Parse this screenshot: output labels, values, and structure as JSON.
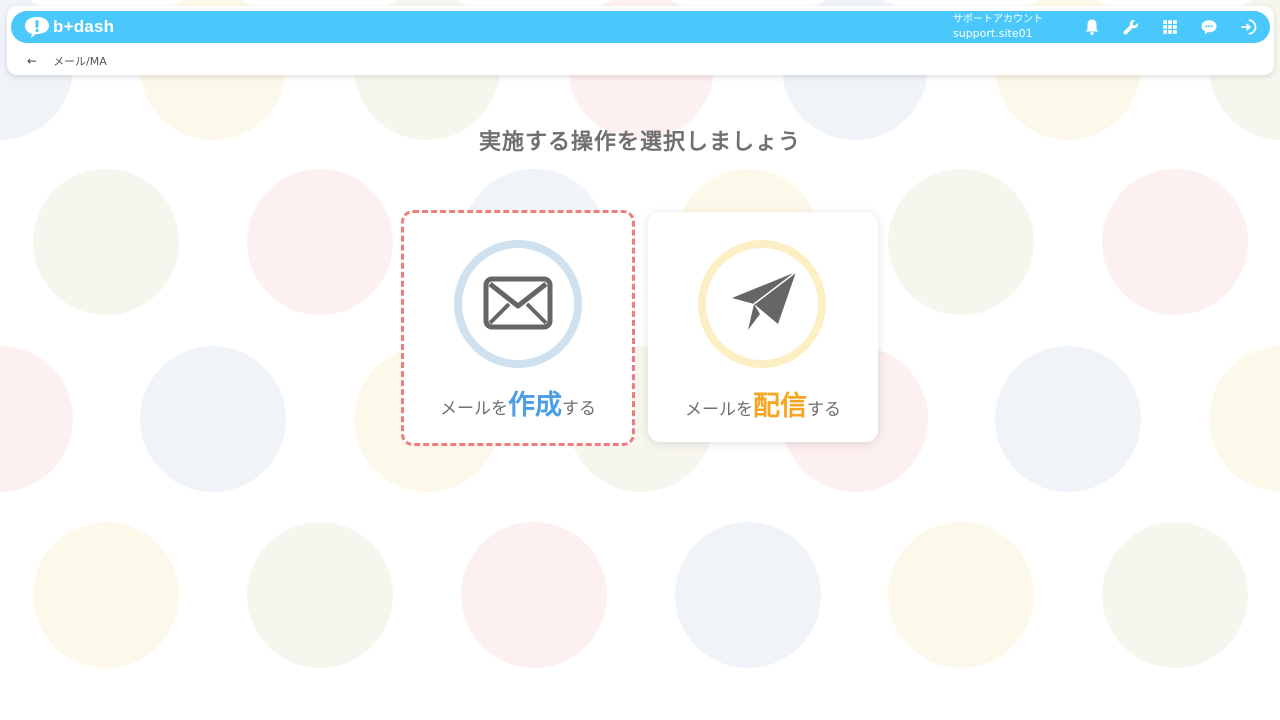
{
  "app": {
    "logo_text": "b+dash"
  },
  "account": {
    "label": "サポートアカウント",
    "id": "support.site01"
  },
  "toolbar": {
    "icons": [
      "bell-icon",
      "wrench-icon",
      "grid-icon",
      "megaphone-icon",
      "logout-icon"
    ]
  },
  "breadcrumb": {
    "path": "メール/MA"
  },
  "page": {
    "title": "実施する操作を選択しましょう"
  },
  "options": {
    "create": {
      "prefix": "メールを",
      "emphasis": "作成",
      "suffix": "する"
    },
    "send": {
      "prefix": "メールを",
      "emphasis": "配信",
      "suffix": "する"
    }
  },
  "colors": {
    "header": "#4ac8fb",
    "accent_blue": "#4a9de6",
    "accent_gold": "#f5a623",
    "selection_border": "#f07c7c"
  }
}
